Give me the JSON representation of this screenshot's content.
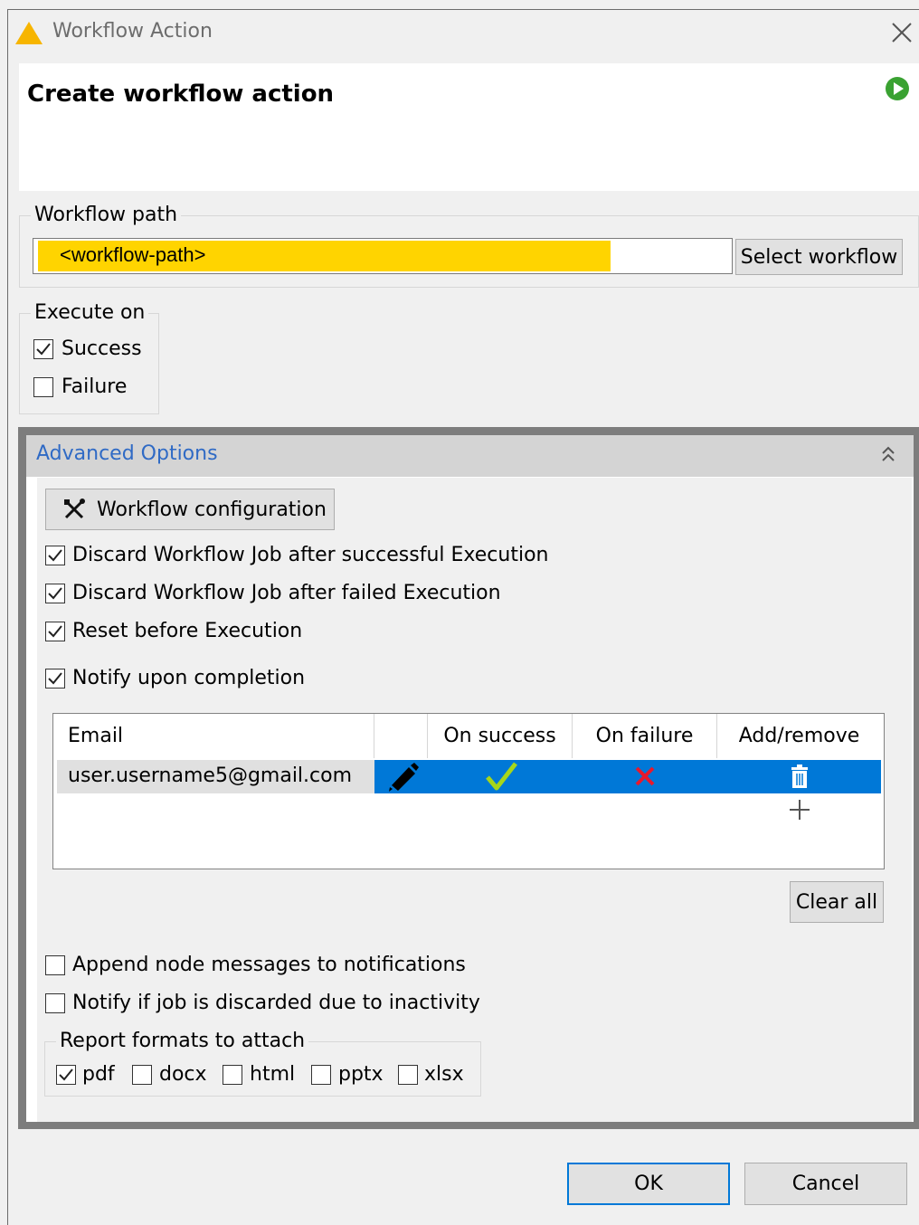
{
  "window": {
    "title": "Workflow Action",
    "header_title": "Create workflow action"
  },
  "workflow_path": {
    "group_label": "Workflow path",
    "value": "<workflow-path>",
    "select_button": "Select workflow"
  },
  "execute_on": {
    "group_label": "Execute on",
    "success": {
      "label": "Success",
      "checked": true
    },
    "failure": {
      "label": "Failure",
      "checked": false
    }
  },
  "advanced": {
    "title": "Advanced Options",
    "config_button": "Workflow configuration",
    "options": [
      {
        "label": "Discard Workflow Job after successful Execution",
        "checked": true
      },
      {
        "label": "Discard Workflow Job after failed Execution",
        "checked": true
      },
      {
        "label": "Reset before Execution",
        "checked": true
      },
      {
        "label": "Notify upon completion",
        "checked": true
      }
    ],
    "table": {
      "headers": [
        "Email",
        "",
        "On success",
        "On failure",
        "Add/remove"
      ],
      "rows": [
        {
          "email": "user.username5@gmail.com",
          "on_success": true,
          "on_failure": false
        }
      ]
    },
    "clear_all": "Clear all",
    "append_messages": {
      "label": "Append node messages to notifications",
      "checked": false
    },
    "notify_discard": {
      "label": "Notify if job is discarded due to inactivity",
      "checked": false
    },
    "report_formats": {
      "group_label": "Report formats to attach",
      "items": [
        {
          "label": "pdf",
          "checked": true
        },
        {
          "label": "docx",
          "checked": false
        },
        {
          "label": "html",
          "checked": false
        },
        {
          "label": "pptx",
          "checked": false
        },
        {
          "label": "xlsx",
          "checked": false
        }
      ]
    }
  },
  "buttons": {
    "ok": "OK",
    "cancel": "Cancel"
  },
  "colors": {
    "accent": "#0078d7",
    "highlight": "#ffd400",
    "link_blue": "#2f6ac5",
    "success_green": "#a6d61a",
    "failure_red": "#e8192c"
  }
}
